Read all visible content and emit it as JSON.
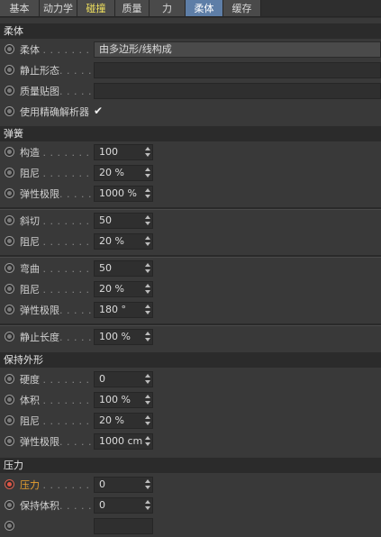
{
  "tabs": [
    {
      "label": "基本",
      "state": "normal"
    },
    {
      "label": "动力学",
      "state": "normal"
    },
    {
      "label": "碰撞",
      "state": "highlight"
    },
    {
      "label": "质量",
      "state": "normal"
    },
    {
      "label": "力",
      "state": "normal"
    },
    {
      "label": "柔体",
      "state": "active"
    },
    {
      "label": "缓存",
      "state": "normal"
    }
  ],
  "softbody": {
    "title": "柔体",
    "softbody_label": "柔体",
    "softbody_value": "由多边形/线构成",
    "rest_shape_label": "静止形态",
    "mass_map_label": "质量贴图",
    "exact_solver_label": "使用精确解析器",
    "exact_solver_check": "✔"
  },
  "springs": {
    "title": "弹簧",
    "structure_label": "构造",
    "structure_value": "100",
    "damping1_label": "阻尼",
    "damping1_value": "20 %",
    "elastic1_label": "弹性极限",
    "elastic1_value": "1000 %",
    "shear_label": "斜切",
    "shear_value": "50",
    "damping2_label": "阻尼",
    "damping2_value": "20 %",
    "flexion_label": "弯曲",
    "flexion_value": "50",
    "damping3_label": "阻尼",
    "damping3_value": "20 %",
    "elastic3_label": "弹性极限",
    "elastic3_value": "180 °",
    "rest_length_label": "静止长度",
    "rest_length_value": "100 %"
  },
  "shape": {
    "title": "保持外形",
    "stiffness_label": "硬度",
    "stiffness_value": "0",
    "volume_label": "体积",
    "volume_value": "100 %",
    "damping_label": "阻尼",
    "damping_value": "20 %",
    "elastic_label": "弹性极限",
    "elastic_value": "1000 cm"
  },
  "pressure": {
    "title": "压力",
    "pressure_label": "压力",
    "pressure_value": "0",
    "keep_volume_label": "保持体积",
    "keep_volume_value": "0"
  },
  "colors": {
    "active_tab": "#5e7ea7",
    "highlight_tab_text": "#f2e35e",
    "animated_param": "#e8a030"
  }
}
